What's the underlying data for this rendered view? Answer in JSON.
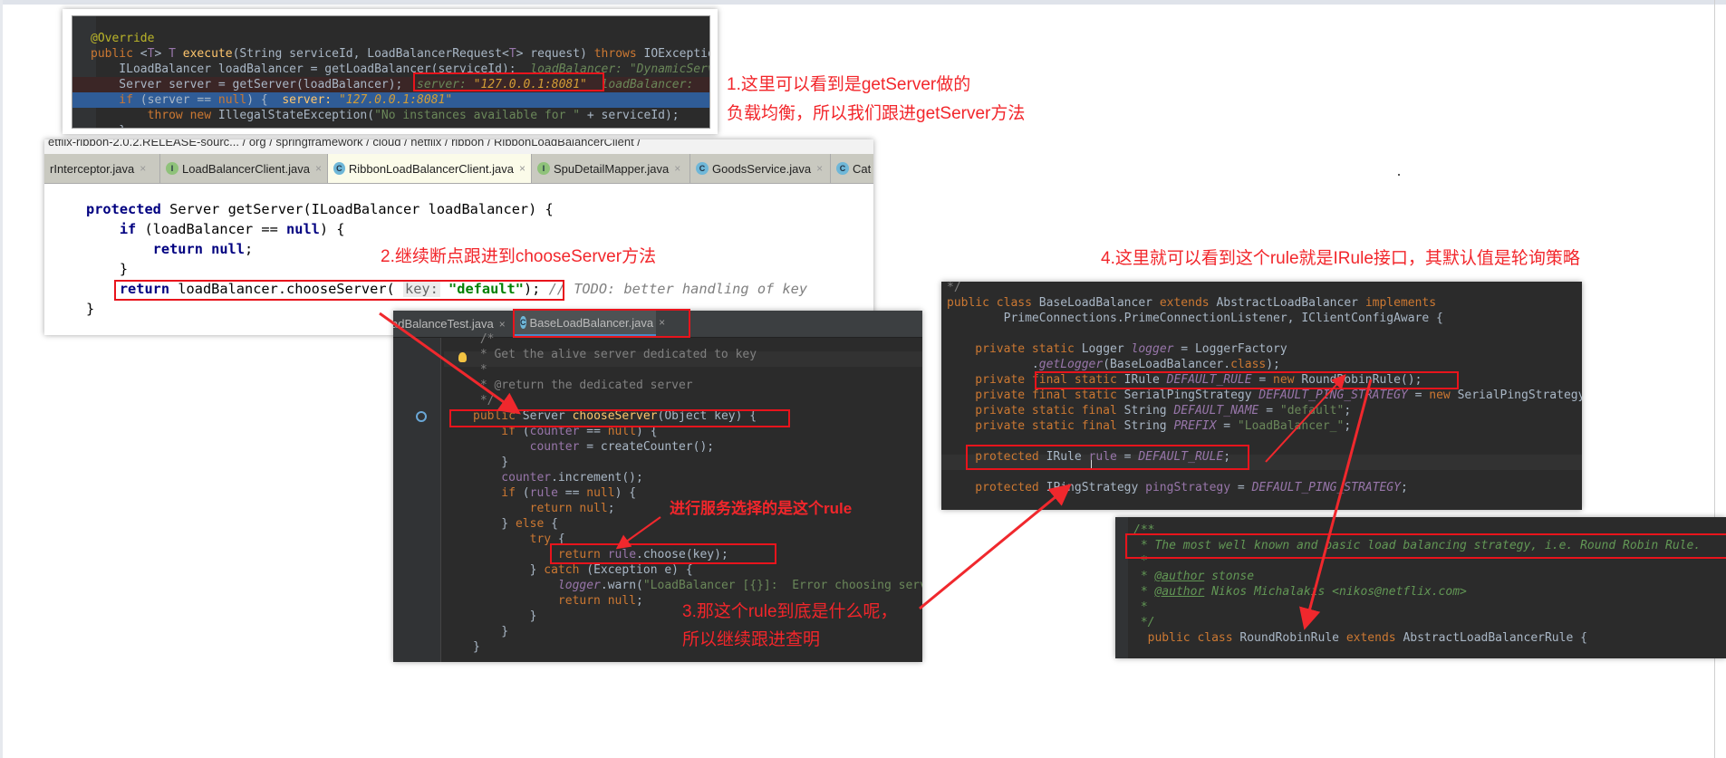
{
  "colors": {
    "accent_red": "#e8141c",
    "darcula_bg": "#2b2b2b",
    "keyword": "#cc7832",
    "string": "#6a8759",
    "field": "#9876aa"
  },
  "panel1": {
    "lines": [
      [
        [
          "a",
          "@Override"
        ]
      ],
      [
        [
          "k",
          "public "
        ],
        [
          "t",
          "<"
        ],
        [
          "f",
          "T"
        ],
        [
          "t",
          "> "
        ],
        [
          "f",
          "T "
        ],
        [
          "fn",
          "execute"
        ],
        [
          "t",
          "(String serviceId, LoadBalancerRequest<"
        ],
        [
          "f",
          "T"
        ],
        [
          "t",
          "> request) "
        ],
        [
          "k",
          "throws "
        ],
        [
          "t",
          "IOException {"
        ]
      ],
      [
        [
          "t",
          "    ILoadBalancer loadBalancer = getLoadBalancer(serviceId);  "
        ],
        [
          "h",
          "loadBalancer: \"DynamicServerListLoadBalancer"
        ]
      ],
      [
        [
          "t",
          "    Server server = getServer(loadBalancer);  "
        ],
        [
          "h",
          "server: "
        ],
        [
          "hs",
          "\"127.0.0.1:8081\""
        ],
        [
          "h",
          "  loadBalancer: "
        ]
      ],
      [
        [
          "k",
          "    if "
        ],
        [
          "t",
          "(server == "
        ],
        [
          "k",
          "null"
        ],
        [
          "t",
          ") {  "
        ],
        [
          "fn",
          "server: "
        ],
        [
          "hs",
          "\"127.0.0.1:8081\""
        ]
      ],
      [
        [
          "k",
          "        throw new "
        ],
        [
          "t",
          "IllegalStateException("
        ],
        [
          "s",
          "\"No instances available for \""
        ],
        [
          "t",
          " + serviceId);"
        ]
      ],
      [
        [
          "t",
          "    }"
        ]
      ]
    ]
  },
  "panel2": {
    "breadcrumb": "etflix-ribbon-2.0.2.RELEASE-sourc... / org / springframework / cloud / netflix / ribbon / RibbonLoadBalancerClient /",
    "tabs": [
      {
        "label": "rInterceptor.java",
        "icon": ""
      },
      {
        "label": "LoadBalancerClient.java",
        "icon": "I"
      },
      {
        "label": "RibbonLoadBalancerClient.java",
        "icon": "C"
      },
      {
        "label": "SpuDetailMapper.java",
        "icon": "I"
      },
      {
        "label": "GoodsService.java",
        "icon": "C"
      },
      {
        "label": "Cat",
        "icon": "C"
      }
    ],
    "close": "×",
    "lines": [
      [
        [
          "lk",
          "protected "
        ],
        [
          "lt",
          "Server getServer(ILoadBalancer loadBalancer) {"
        ]
      ],
      [
        [
          "lk",
          "    if "
        ],
        [
          "lt",
          "(loadBalancer == "
        ],
        [
          "lk",
          "null"
        ],
        [
          "lt",
          ") {"
        ]
      ],
      [
        [
          "lk",
          "        return null"
        ],
        [
          "lt",
          ";"
        ]
      ],
      [
        [
          "lt",
          "    }"
        ]
      ],
      [
        [
          "lk",
          "    return "
        ],
        [
          "lt",
          "loadBalancer.chooseServer( "
        ],
        [
          "lh",
          "key:"
        ],
        [
          "lt",
          " "
        ],
        [
          "ls",
          "\"default\""
        ],
        [
          "lt",
          "); "
        ],
        [
          "lc",
          "// TODO: better handling of key"
        ]
      ],
      [
        [
          "lt",
          "}"
        ]
      ]
    ]
  },
  "panel3": {
    "tabs": [
      {
        "label": "adBalanceTest.java"
      },
      {
        "label": "BaseLoadBalancer.java",
        "icon": "C"
      }
    ],
    "close": "×",
    "lines": [
      [
        [
          "c",
          " /*"
        ]
      ],
      [
        [
          "c",
          " * Get the alive server dedicated to key"
        ]
      ],
      [
        [
          "c",
          " *"
        ]
      ],
      [
        [
          "c",
          " * @return the dedicated server"
        ]
      ],
      [
        [
          "c",
          " */"
        ]
      ],
      [
        [
          "k",
          "public "
        ],
        [
          "t",
          "Server "
        ],
        [
          "fn",
          "chooseServer"
        ],
        [
          "t",
          "(Object key) {"
        ]
      ],
      [
        [
          "k",
          "    if "
        ],
        [
          "t",
          "("
        ],
        [
          "f",
          "counter"
        ],
        [
          "t",
          " == "
        ],
        [
          "k",
          "null"
        ],
        [
          "t",
          ") {"
        ]
      ],
      [
        [
          "f",
          "        counter"
        ],
        [
          "t",
          " = createCounter();"
        ]
      ],
      [
        [
          "t",
          "    }"
        ]
      ],
      [
        [
          "f",
          "    counter"
        ],
        [
          "t",
          ".increment();"
        ]
      ],
      [
        [
          "k",
          "    if "
        ],
        [
          "t",
          "("
        ],
        [
          "f",
          "rule"
        ],
        [
          "t",
          " == "
        ],
        [
          "k",
          "null"
        ],
        [
          "t",
          ") {"
        ]
      ],
      [
        [
          "k",
          "        return null"
        ],
        [
          "t",
          ";"
        ]
      ],
      [
        [
          "t",
          "    } "
        ],
        [
          "k",
          "else "
        ],
        [
          "t",
          "{"
        ]
      ],
      [
        [
          "k",
          "        try "
        ],
        [
          "t",
          "{"
        ]
      ],
      [
        [
          "k",
          "            return "
        ],
        [
          "f",
          "rule"
        ],
        [
          "t",
          ".choose(key);"
        ]
      ],
      [
        [
          "t",
          "        } "
        ],
        [
          "k",
          "catch "
        ],
        [
          "t",
          "(Exception e) {"
        ]
      ],
      [
        [
          "fi",
          "            logger"
        ],
        [
          "t",
          ".warn("
        ],
        [
          "s",
          "\"LoadBalancer [{}]:  Error choosing server for key {}\""
        ]
      ],
      [
        [
          "k",
          "            return null"
        ],
        [
          "t",
          ";"
        ]
      ],
      [
        [
          "t",
          "        }"
        ]
      ],
      [
        [
          "t",
          "    }"
        ]
      ],
      [
        [
          "t",
          "}"
        ]
      ]
    ]
  },
  "panel4": {
    "lines": [
      [
        [
          "c",
          "*/"
        ]
      ],
      [
        [
          "k",
          "public class "
        ],
        [
          "t",
          "BaseLoadBalancer "
        ],
        [
          "k",
          "extends "
        ],
        [
          "t",
          "AbstractLoadBalancer "
        ],
        [
          "k",
          "implements"
        ]
      ],
      [
        [
          "t",
          "        PrimeConnections.PrimeConnectionListener, IClientConfigAware {"
        ]
      ],
      [
        [
          "t",
          ""
        ]
      ],
      [
        [
          "k",
          "    private static "
        ],
        [
          "t",
          "Logger "
        ],
        [
          "fi",
          "logger"
        ],
        [
          "t",
          " = LoggerFactory"
        ]
      ],
      [
        [
          "t",
          "            ."
        ],
        [
          "fi",
          "getLogger"
        ],
        [
          "t",
          "(BaseLoadBalancer."
        ],
        [
          "k",
          "class"
        ],
        [
          "t",
          ");"
        ]
      ],
      [
        [
          "k",
          "    private final static "
        ],
        [
          "t",
          "IRule "
        ],
        [
          "fi",
          "DEFAULT_RULE"
        ],
        [
          "t",
          " = "
        ],
        [
          "k",
          "new "
        ],
        [
          "t",
          "RoundRobinRule();"
        ]
      ],
      [
        [
          "k",
          "    private final static "
        ],
        [
          "t",
          "SerialPingStrategy "
        ],
        [
          "fi",
          "DEFAULT_PING_STRATEGY"
        ],
        [
          "t",
          " = "
        ],
        [
          "k",
          "new "
        ],
        [
          "t",
          "SerialPingStrategy();"
        ]
      ],
      [
        [
          "k",
          "    private static final "
        ],
        [
          "t",
          "String "
        ],
        [
          "fi",
          "DEFAULT_NAME"
        ],
        [
          "t",
          " = "
        ],
        [
          "s",
          "\"default\""
        ],
        [
          "t",
          ";"
        ]
      ],
      [
        [
          "k",
          "    private static final "
        ],
        [
          "t",
          "String "
        ],
        [
          "fi",
          "PREFIX"
        ],
        [
          "t",
          " = "
        ],
        [
          "s",
          "\"LoadBalancer_\""
        ],
        [
          "t",
          ";"
        ]
      ],
      [
        [
          "t",
          ""
        ]
      ],
      [
        [
          "k",
          "    protected "
        ],
        [
          "t",
          "IRule "
        ],
        [
          "f",
          "rule"
        ],
        [
          "t",
          " = "
        ],
        [
          "fi",
          "DEFAULT_RULE"
        ],
        [
          "t",
          ";"
        ]
      ],
      [
        [
          "t",
          ""
        ]
      ],
      [
        [
          "k",
          "    protected "
        ],
        [
          "t",
          "IPingStrategy "
        ],
        [
          "f",
          "pingStrategy"
        ],
        [
          "t",
          " = "
        ],
        [
          "fi",
          "DEFAULT_PING_STRATEGY"
        ],
        [
          "t",
          ";"
        ]
      ]
    ]
  },
  "panel5": {
    "lines": [
      [
        [
          "d",
          "/**"
        ]
      ],
      [
        [
          "d",
          " * The most well known and basic load balancing strategy, i.e. Round Robin Rule."
        ]
      ],
      [
        [
          "d",
          " *"
        ]
      ],
      [
        [
          "d",
          " * "
        ],
        [
          "du",
          "@author"
        ],
        [
          "d",
          " stonse"
        ]
      ],
      [
        [
          "d",
          " * "
        ],
        [
          "du",
          "@author"
        ],
        [
          "d",
          " Nikos Michalakis <nikos@netflix.com>"
        ]
      ],
      [
        [
          "d",
          " *"
        ]
      ],
      [
        [
          "d",
          " */"
        ]
      ],
      [
        [
          "k",
          "  public class "
        ],
        [
          "t",
          "RoundRobinRule "
        ],
        [
          "k",
          "extends "
        ],
        [
          "t",
          "AbstractLoadBalancerRule {"
        ]
      ]
    ]
  },
  "annotations": {
    "note1_line1": "1.这里可以看到是getServer做的",
    "note1_line2": "负载均衡，所以我们跟进getServer方法",
    "note2": "2.继续断点跟进到chooseServer方法",
    "note_rule": "进行服务选择的是这个rule",
    "note3_line1": "3.那这个rule到底是什么呢，",
    "note3_line2": "所以继续跟进查明",
    "note4": "4.这里就可以看到这个rule就是IRule接口，其默认值是轮询策略"
  }
}
